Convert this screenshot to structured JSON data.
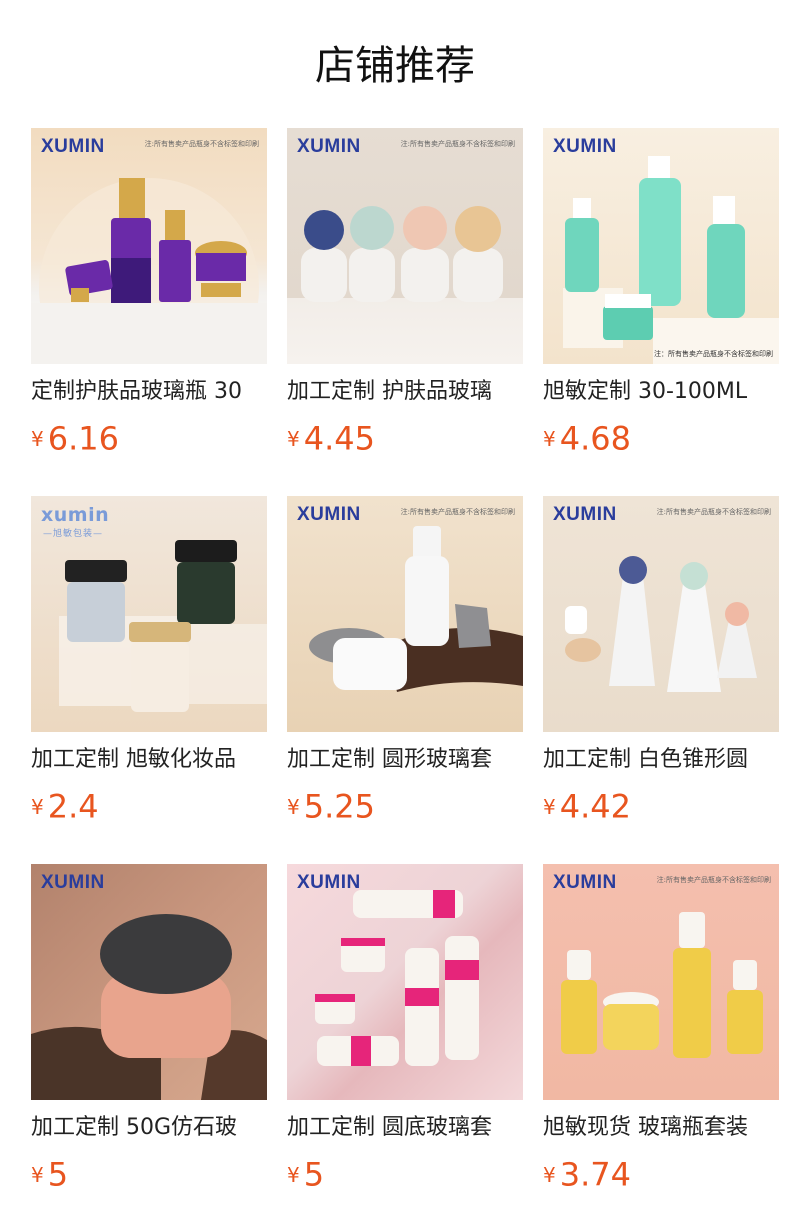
{
  "page": {
    "title": "店铺推荐"
  },
  "colors": {
    "price": "#e8551f",
    "brand_blue": "#2a3d9c",
    "brand_light": "#7a9bd8"
  },
  "products": [
    {
      "brand": "XUMIN",
      "notice": "注:所有售卖产品瓶身不含标签和印刷",
      "name": "定制护肤品玻璃瓶 30",
      "currency": "¥",
      "price": "6.16",
      "image_icon": "purple-gold-bottles-image"
    },
    {
      "brand": "XUMIN",
      "notice": "注:所有售卖产品瓶身不含标签和印刷",
      "name": "加工定制 护肤品玻璃",
      "currency": "¥",
      "price": "4.45",
      "image_icon": "stone-cap-bottles-image"
    },
    {
      "brand": "XUMIN",
      "notice": "注：所有售卖产品瓶身不含标签和印刷",
      "name": "旭敏定制 30-100ML",
      "currency": "¥",
      "price": "4.68",
      "image_icon": "mint-green-bottles-image"
    },
    {
      "brand": "xumin",
      "sub": "—旭敏包装—",
      "name": "加工定制 旭敏化妆品",
      "currency": "¥",
      "price": "2.4",
      "image_icon": "cream-jars-image"
    },
    {
      "brand": "XUMIN",
      "notice": "注:所有售卖产品瓶身不含标签和印刷",
      "name": "加工定制 圆形玻璃套",
      "currency": "¥",
      "price": "5.25",
      "image_icon": "white-glass-set-image"
    },
    {
      "brand": "XUMIN",
      "notice": "注:所有售卖产品瓶身不含标签和印刷",
      "name": "加工定制 白色锥形圆",
      "currency": "¥",
      "price": "4.42",
      "image_icon": "cone-bottles-image"
    },
    {
      "brand": "XUMIN",
      "name": "加工定制 50G仿石玻",
      "currency": "¥",
      "price": "5",
      "image_icon": "stone-jar-image"
    },
    {
      "brand": "XUMIN",
      "name": "加工定制 圆底玻璃套",
      "currency": "¥",
      "price": "5",
      "image_icon": "pink-white-set-image"
    },
    {
      "brand": "XUMIN",
      "notice": "注:所有售卖产品瓶身不含标签和印刷",
      "name": "旭敏现货 玻璃瓶套装",
      "currency": "¥",
      "price": "3.74",
      "image_icon": "yellow-serum-bottles-image"
    }
  ]
}
